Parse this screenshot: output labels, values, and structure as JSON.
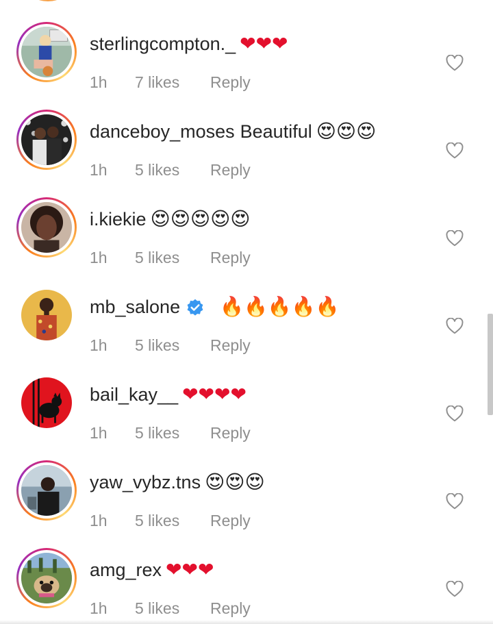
{
  "comments": [
    {
      "username": "sterlingcompton._",
      "text": "",
      "verified": false,
      "emoji": "❤❤❤",
      "emoji_type": "red-heart",
      "time": "1h",
      "likes": "7 likes",
      "reply": "Reply",
      "avatar_ring": true,
      "avatar_icon": "person-basketball-avatar"
    },
    {
      "username": "danceboy_moses",
      "text": "Beautiful",
      "verified": false,
      "emoji": "😍😍😍",
      "emoji_type": "heart-eyes",
      "time": "1h",
      "likes": "5 likes",
      "reply": "Reply",
      "avatar_ring": true,
      "avatar_icon": "couple-avatar"
    },
    {
      "username": "i.kiekie",
      "text": "",
      "verified": false,
      "emoji": "😍😍😍😍😍",
      "emoji_type": "heart-eyes",
      "time": "1h",
      "likes": "5 likes",
      "reply": "Reply",
      "avatar_ring": true,
      "avatar_icon": "portrait-avatar"
    },
    {
      "username": "mb_salone",
      "text": "",
      "verified": true,
      "emoji": "🔥🔥🔥🔥🔥",
      "emoji_type": "fire",
      "time": "1h",
      "likes": "5 likes",
      "reply": "Reply",
      "avatar_ring": false,
      "avatar_icon": "man-yellow-avatar"
    },
    {
      "username": "bail_kay__",
      "text": "",
      "verified": false,
      "emoji": "❤❤❤❤",
      "emoji_type": "red-heart",
      "time": "1h",
      "likes": "5 likes",
      "reply": "Reply",
      "avatar_ring": false,
      "avatar_icon": "black-cat-red-avatar"
    },
    {
      "username": "yaw_vybz.tns",
      "text": "",
      "verified": false,
      "emoji": "😍😍😍",
      "emoji_type": "heart-eyes",
      "time": "1h",
      "likes": "5 likes",
      "reply": "Reply",
      "avatar_ring": true,
      "avatar_icon": "man-photo-avatar"
    },
    {
      "username": "amg_rex",
      "text": "",
      "verified": false,
      "emoji": "❤❤❤",
      "emoji_type": "red-heart",
      "time": "1h",
      "likes": "5 likes",
      "reply": "Reply",
      "avatar_ring": true,
      "avatar_icon": "pug-avatar"
    }
  ],
  "colors": {
    "username": "#262626",
    "meta": "#8e8e8e",
    "heart_red": "#e3102d",
    "verified_blue": "#3897f0",
    "ring_gradient": [
      "#d62976",
      "#fa7e1e",
      "#feda75",
      "#962fbf"
    ]
  },
  "icons": {
    "like_button": "heart-outline-icon",
    "verified_badge": "verified-badge-icon"
  }
}
